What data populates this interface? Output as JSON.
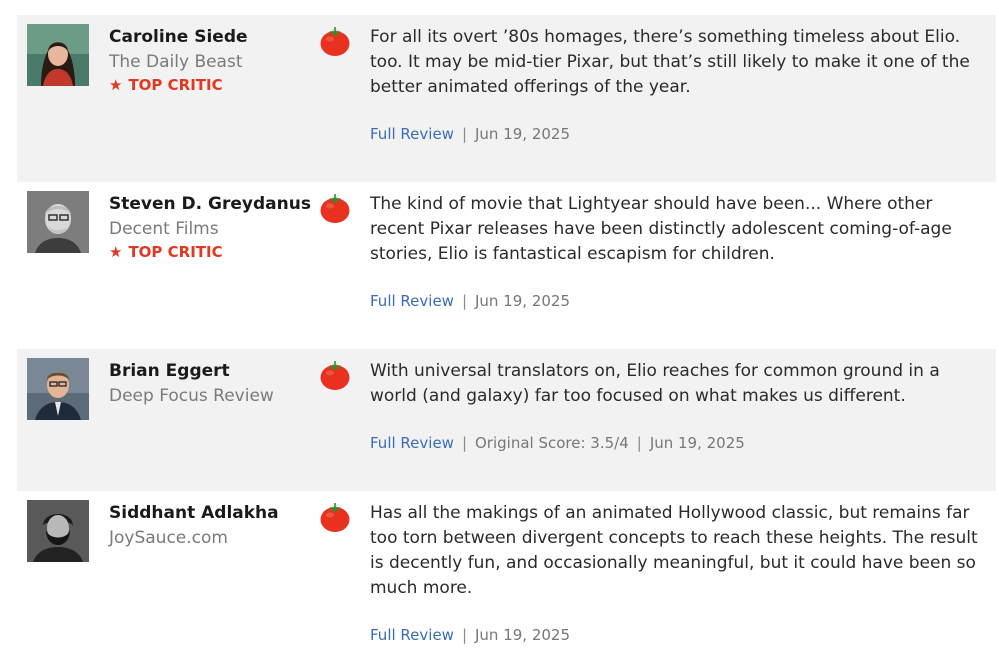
{
  "reviews": [
    {
      "critic": "Caroline Siede",
      "publication": "The Daily Beast",
      "top_critic": "TOP CRITIC",
      "quote": "For all its overt ’80s homages, there’s something timeless about Elio. too. It may be mid-tier Pixar, but that’s still likely to make it one of the better animated offerings of the year.",
      "link_label": "Full Review",
      "date": "Jun 19, 2025",
      "rating_icon": "fresh-tomato-icon"
    },
    {
      "critic": "Steven D. Greydanus",
      "publication": "Decent Films",
      "top_critic": "TOP CRITIC",
      "quote": "The kind of movie that Lightyear should have been... Where other recent Pixar releases have been distinctly adolescent coming-of-age stories, Elio is fantastical escapism for children.",
      "link_label": "Full Review",
      "date": "Jun 19, 2025",
      "rating_icon": "fresh-tomato-icon"
    },
    {
      "critic": "Brian Eggert",
      "publication": "Deep Focus Review",
      "quote": "With universal translators on, Elio reaches for common ground in a world (and galaxy) far too focused on what makes us different.",
      "link_label": "Full Review",
      "score": "Original Score: 3.5/4",
      "date": "Jun 19, 2025",
      "rating_icon": "fresh-tomato-icon"
    },
    {
      "critic": "Siddhant Adlakha",
      "publication": "JoySauce.com",
      "quote": "Has all the makings of an animated Hollywood classic, but remains far too torn between divergent concepts to reach these heights. The result is decently fun, and occasionally meaningful, but it could have been so much more.",
      "link_label": "Full Review",
      "date": "Jun 19, 2025",
      "rating_icon": "fresh-tomato-icon"
    }
  ],
  "colors": {
    "row_shade": "#f2f2f2",
    "top_critic": "#e0391f",
    "link": "#3a6cb8",
    "tomato": "#e8321f"
  }
}
